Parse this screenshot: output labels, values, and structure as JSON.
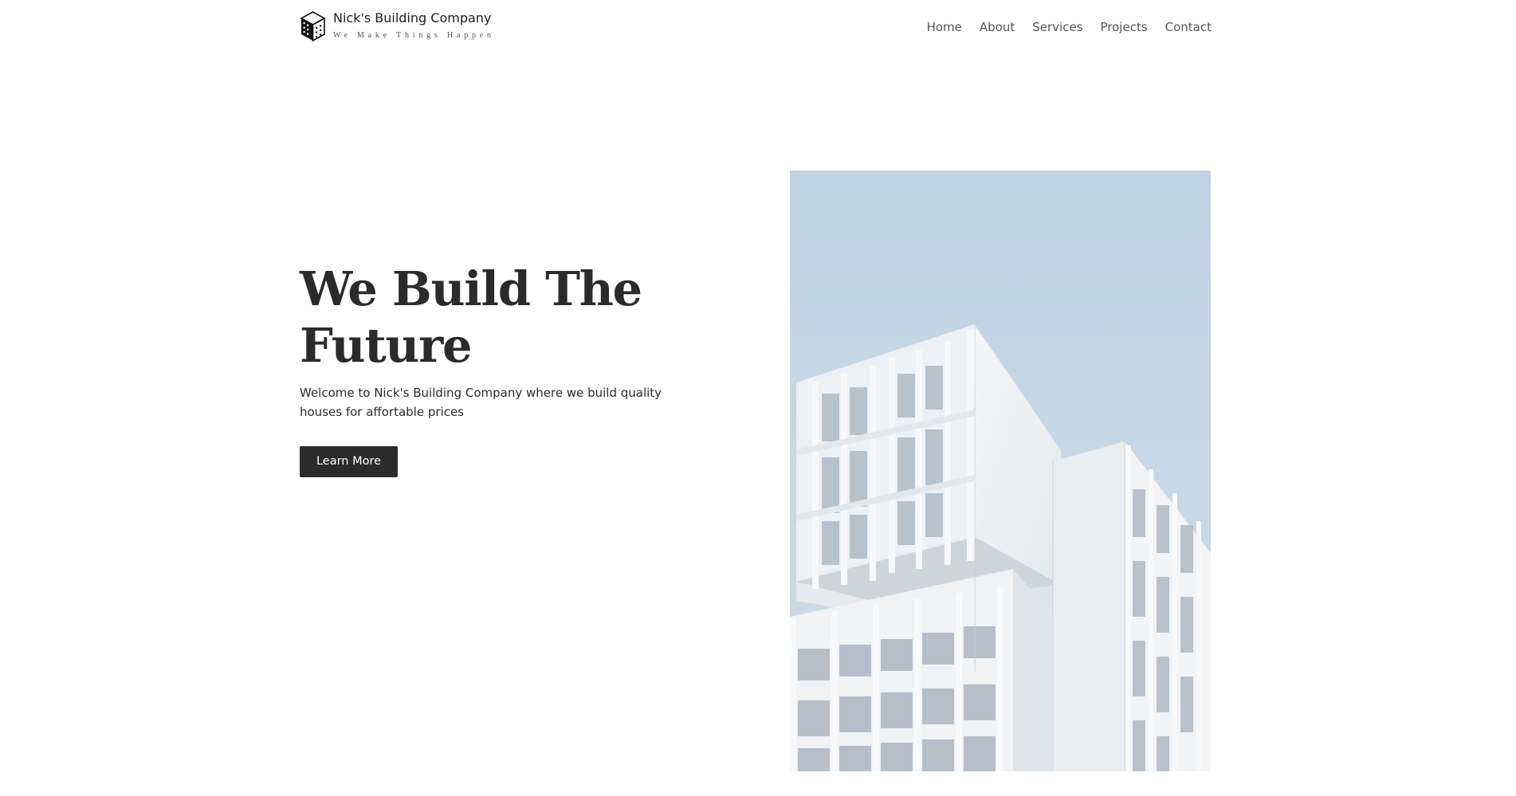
{
  "brand": {
    "name": "Nick's Building Company",
    "tagline": "We Make Things Happen",
    "logo_icon": "building-cube-icon"
  },
  "nav": {
    "items": [
      {
        "label": "Home"
      },
      {
        "label": "About"
      },
      {
        "label": "Services"
      },
      {
        "label": "Projects"
      },
      {
        "label": "Contact"
      }
    ]
  },
  "hero": {
    "title": "We Build The Future",
    "subtitle": "Welcome to Nick's Building Company where we build quality houses for affortable prices",
    "cta_label": "Learn More",
    "image_subject": "modern-white-building-photo"
  },
  "colors": {
    "text_dark": "#2b2b2b",
    "nav_text": "#555555",
    "button_bg": "#2b2b2b",
    "button_text": "#ffffff",
    "sky": "#c3d4e2",
    "background": "#ffffff"
  }
}
